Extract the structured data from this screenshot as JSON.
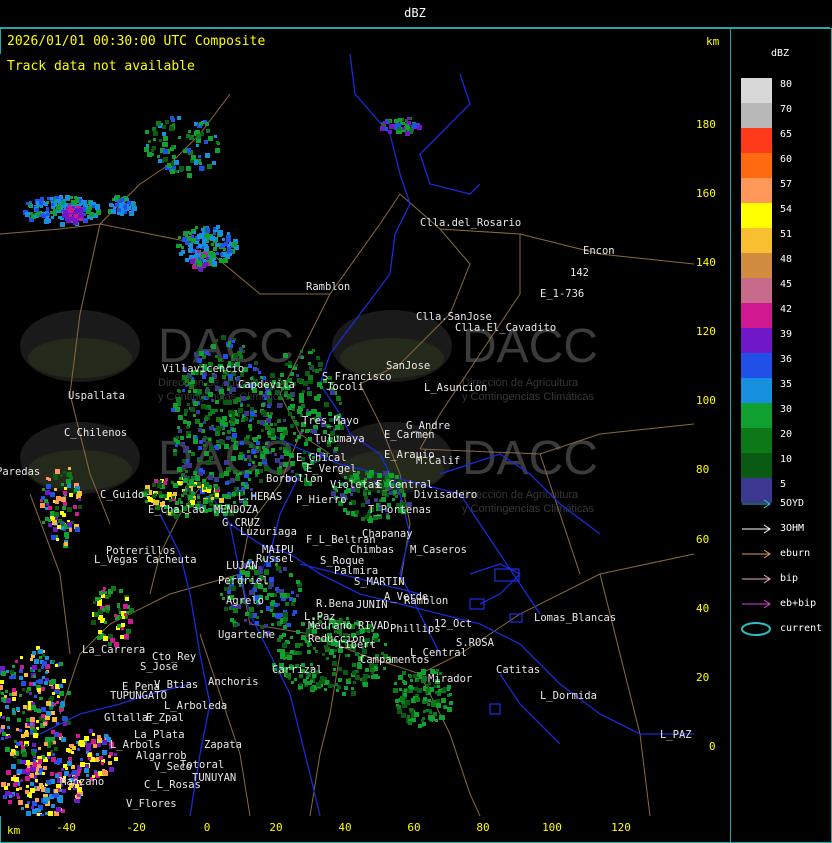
{
  "header": {
    "title": "dBZ"
  },
  "map": {
    "timestamp": "2026/01/01 00:30:00 UTC Composite",
    "status": "Track data not available",
    "km_label_top": "km",
    "km_label_bottom": "km",
    "y_ticks": [
      "180",
      "160",
      "140",
      "120",
      "100",
      "80",
      "60",
      "40",
      "20",
      "0"
    ],
    "x_ticks": [
      "-40",
      "-20",
      "0",
      "20",
      "40",
      "60",
      "80",
      "100",
      "120"
    ],
    "watermark": {
      "brand": "DACC",
      "line1": "Dirección de Agricultura",
      "line2": "y Contingencias Climáticas"
    },
    "places": [
      "Clla.del_Rosario",
      "Encon",
      "142",
      "E_1-736",
      "Ramblon",
      "Clla.SanJose",
      "Clla.El_Cavadito",
      "Villavicencio",
      "Capdevila",
      "S_Francisco",
      "SanJose",
      "Jocoli",
      "L_Asuncion",
      "Uspallata",
      "Tres_Mayo",
      "G_Andre",
      "Tulumaya",
      "E_Carmen",
      "C_Chilenos",
      "E_Arauio",
      "M.Calif",
      "E_Chical",
      "E_Vergel",
      "Borbollon",
      "Violetas",
      "E_Central",
      "Divisadero",
      "C_Guido",
      "L.HERAS",
      "P_Hierro",
      "T_Portenas",
      "E_Challao",
      "MENDOZA",
      "G.CRUZ",
      "Luzuriaga",
      "Chapanay",
      "F_L_Beltran",
      "Potrerillos",
      "MAIPU",
      "L_Vegas",
      "Cacheuta",
      "Russel",
      "S_Roque",
      "Chimbas",
      "M_Caseros",
      "LUJAN",
      "Palmira",
      "Perdriel",
      "S_MARTIN",
      "A_Verde",
      "Agrelo",
      "Ramblon",
      "R.Bena",
      "JUNIN",
      "L.Paz",
      "Lomas_Blancas",
      "12_Oct",
      "RIVAD",
      "Medrano",
      "Phillips",
      "S.ROSA",
      "Ugarteche",
      "Reduccion",
      "Libert",
      "L_Central",
      "La_Carrera",
      "Cto_Rey",
      "S_Jose",
      "Carrizal",
      "Campamentos",
      "Catitas",
      "Anchoris",
      "Mirador",
      "E_Pena",
      "V_Btias",
      "TUPUNGATO",
      "L_Dormida",
      "L_Arboleda",
      "Gltallar",
      "E_Zpal",
      "La_Plata",
      "L_Arbols",
      "Zapata",
      "Algarrob",
      "Totoral",
      "V_Seco",
      "TUNUYAN",
      "Manzano",
      "C_L_Rosas",
      "V_Flores",
      "L_PAZ",
      "Paredas"
    ]
  },
  "legend": {
    "unit": "dBZ",
    "levels": [
      {
        "label": "80",
        "color": "#d8d8d8"
      },
      {
        "label": "70",
        "color": "#b8b8b8"
      },
      {
        "label": "65",
        "color": "#ff3a1a"
      },
      {
        "label": "60",
        "color": "#ff6a10"
      },
      {
        "label": "57",
        "color": "#ff9858"
      },
      {
        "label": "54",
        "color": "#ffff00"
      },
      {
        "label": "51",
        "color": "#f8c030"
      },
      {
        "label": "48",
        "color": "#d28c40"
      },
      {
        "label": "45",
        "color": "#c86a8a"
      },
      {
        "label": "42",
        "color": "#d01890"
      },
      {
        "label": "39",
        "color": "#7018c8"
      },
      {
        "label": "36",
        "color": "#2050e8"
      },
      {
        "label": "35",
        "color": "#1890e0"
      },
      {
        "label": "30",
        "color": "#10a030"
      },
      {
        "label": "20",
        "color": "#0c7818"
      },
      {
        "label": "10",
        "color": "#0a5a14"
      },
      {
        "label": "5",
        "color": "#3c3890"
      }
    ],
    "tracks": [
      {
        "label": "5OYD",
        "color": "#30c0c0"
      },
      {
        "label": "3OHM",
        "color": "#ffffff"
      },
      {
        "label": "eburn",
        "color": "#e0a060"
      },
      {
        "label": "bip",
        "color": "#f0b0c0"
      },
      {
        "label": "eb+bip",
        "color": "#e040e0"
      },
      {
        "label": "current",
        "color": "#30c0c0"
      }
    ]
  }
}
